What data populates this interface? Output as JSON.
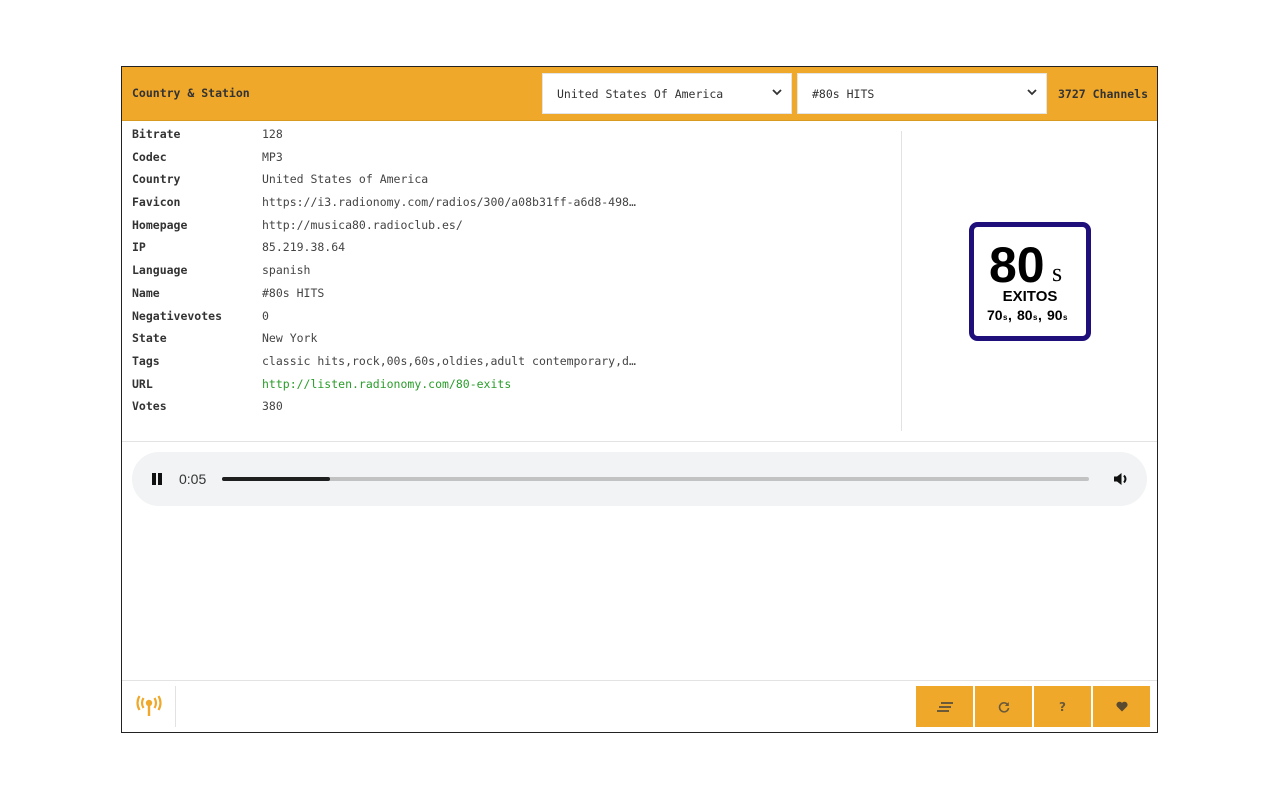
{
  "header": {
    "title": "Country & Station",
    "country_select": {
      "selected": "United States Of America"
    },
    "station_select": {
      "selected": "#80s HITS"
    },
    "channel_count": "3727",
    "channel_label": "Channels"
  },
  "details": [
    {
      "key": "Bitrate",
      "value": "128"
    },
    {
      "key": "Codec",
      "value": "MP3"
    },
    {
      "key": "Country",
      "value": "United States of America"
    },
    {
      "key": "Favicon",
      "value": "https://i3.radionomy.com/radios/300/a08b31ff-a6d8-498…"
    },
    {
      "key": "Homepage",
      "value": "http://musica80.radioclub.es/"
    },
    {
      "key": "IP",
      "value": "85.219.38.64"
    },
    {
      "key": "Language",
      "value": "spanish"
    },
    {
      "key": "Name",
      "value": "#80s HITS"
    },
    {
      "key": "Negativevotes",
      "value": "0"
    },
    {
      "key": "State",
      "value": "New York"
    },
    {
      "key": "Tags",
      "value": "classic hits,rock,00s,60s,oldies,adult contemporary,d…"
    },
    {
      "key": "URL",
      "value": "http://listen.radionomy.com/80-exits"
    },
    {
      "key": "Votes",
      "value": "380"
    }
  ],
  "logo": {
    "big": "80",
    "big_suffix": "s",
    "subtitle": "EXITOS",
    "decades": [
      "70",
      "80",
      "90"
    ],
    "decade_suffix": "s",
    "border_color": "#1e0f7a"
  },
  "player": {
    "state": "playing",
    "current_time": "0:05",
    "progress_fraction": 0.125
  },
  "footer": {
    "buttons": [
      {
        "name": "list",
        "icon": "list-icon"
      },
      {
        "name": "refresh",
        "icon": "refresh-icon"
      },
      {
        "name": "help",
        "icon": "help-icon",
        "label": "?"
      },
      {
        "name": "favorite",
        "icon": "heart-icon"
      }
    ]
  },
  "colors": {
    "accent": "#f0a82a",
    "link": "#2a9d2a"
  }
}
